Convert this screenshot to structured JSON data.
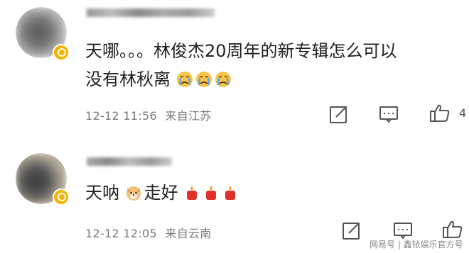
{
  "comments": [
    {
      "text_line1": "天哪。。。林俊杰20周年的新专辑怎么可以",
      "text_line2": "没有林秋离",
      "emoji": [
        "crying-face-icon",
        "crying-face-icon",
        "crying-face-icon"
      ],
      "timestamp": "12-12 11:56",
      "location": "来自江苏",
      "like_count": "4"
    },
    {
      "text": "天呐",
      "text_after": "走好",
      "emoji_mid": "dog-face-icon",
      "emoji_end": [
        "candle-icon",
        "candle-icon",
        "candle-icon"
      ],
      "timestamp": "12-12 12:05",
      "location": "来自云南"
    }
  ],
  "watermark": "网易号 | 鑫铱娱乐官方号",
  "colors": {
    "text": "#222222",
    "meta": "#7a7a7a",
    "icon": "#555555",
    "badge": "#f4b400"
  }
}
